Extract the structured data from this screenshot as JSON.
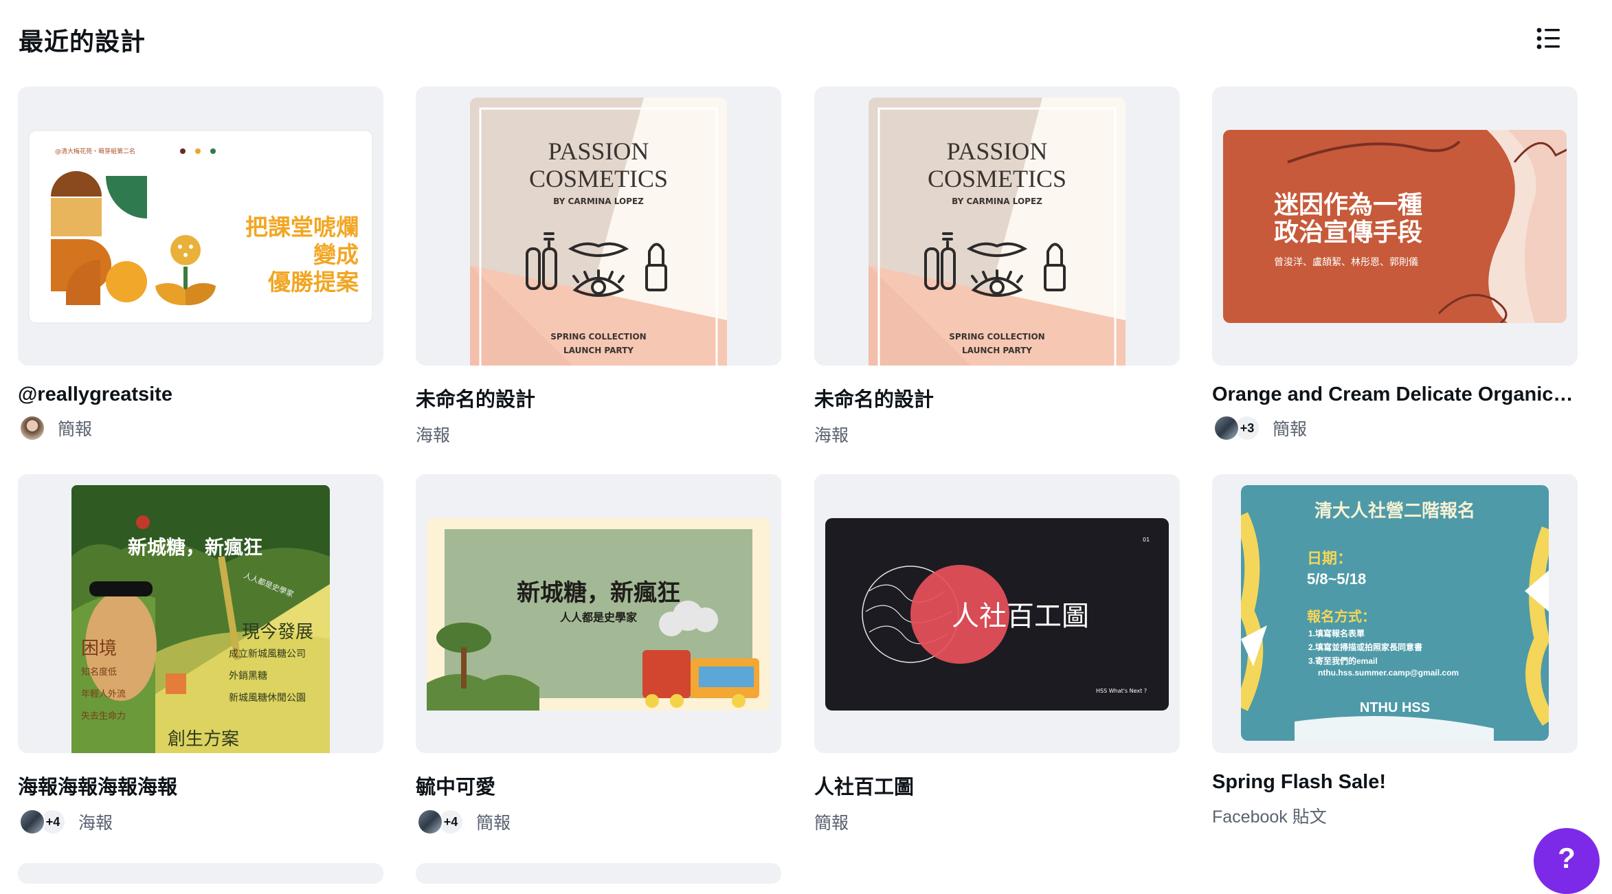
{
  "page": {
    "heading": "最近的設計"
  },
  "toolbar": {
    "view_toggle_icon": "list-view-icon"
  },
  "help_button": {
    "label": "?"
  },
  "designs": [
    {
      "title": "@reallygreatsite",
      "type": "簡報",
      "thumbnail": {
        "caption": "@清大梅花苑・萌芽組第二名",
        "text_lines": [
          "把課堂唬爛",
          "變成",
          "優勝提案"
        ]
      }
    },
    {
      "title": "未命名的設計",
      "type": "海報",
      "thumbnail": {
        "title_1": "PASSION",
        "title_2": "COSMETICS",
        "byline": "BY CARMINA LOPEZ",
        "footer_1": "SPRING COLLECTION",
        "footer_2": "LAUNCH PARTY"
      }
    },
    {
      "title": "未命名的設計",
      "type": "海報",
      "thumbnail": {
        "title_1": "PASSION",
        "title_2": "COSMETICS",
        "byline": "BY CARMINA LOPEZ",
        "footer_1": "SPRING COLLECTION",
        "footer_2": "LAUNCH PARTY"
      }
    },
    {
      "title": "Orange and Cream Delicate Organic Abstract Presentation",
      "type": "簡報",
      "collaborators_extra": "+3",
      "thumbnail": {
        "line_1": "迷因作為一種",
        "line_2": "政治宣傳手段",
        "names": "曾浚洋、盧頡絜、林彤恩、郭則儀"
      }
    },
    {
      "title": "海報海報海報海報",
      "type": "海報",
      "collaborators_extra": "+4",
      "thumbnail": {
        "headline": "新城糖，新瘋狂",
        "sub": "人人都是史學家",
        "left_title": "困境",
        "left_items": [
          "知名度低",
          "年輕人外流",
          "失去生命力"
        ],
        "right_title": "現今發展",
        "right_items": [
          "成立新城風糖公司",
          "外銷黑糖",
          "新城風糖休閒公園"
        ],
        "bottom": "創生方案"
      }
    },
    {
      "title": "毓中可愛",
      "type": "簡報",
      "collaborators_extra": "+4",
      "thumbnail": {
        "headline": "新城糖，新瘋狂",
        "sub": "人人都是史學家"
      }
    },
    {
      "title": "人社百工圖",
      "type": "簡報",
      "thumbnail": {
        "headline": "人社百工圖",
        "page_no": "01",
        "footer": "HSS What's Next ?"
      }
    },
    {
      "title": "Spring Flash Sale!",
      "type": "Facebook 貼文",
      "thumbnail": {
        "headline": "清大人社營二階報名",
        "date_label": "日期：",
        "date": "5/8~5/18",
        "method_label": "報名方式：",
        "steps": [
          "1.填寫報名表單",
          "2.填寫並掃描或拍照家長同意書",
          "3.寄至我們的email"
        ],
        "email": "nthu.hss.summer.camp@gmail.com",
        "brand": "NTHU HSS"
      }
    }
  ]
}
